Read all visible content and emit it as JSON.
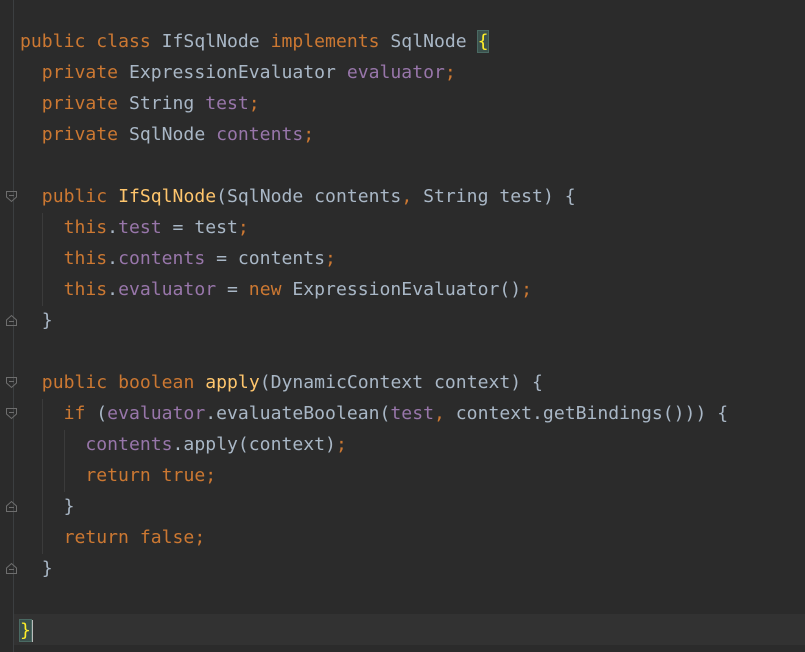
{
  "theme": {
    "background": "#2b2b2b",
    "keyword": "#cc7832",
    "field": "#9876aa",
    "method_decl": "#ffc66d",
    "plain": "#a9b7c6",
    "brace_highlight": "#3b514d"
  },
  "code": {
    "lines": [
      [
        [
          "kw",
          "public"
        ],
        [
          "pl",
          " "
        ],
        [
          "kw",
          "class"
        ],
        [
          "pl",
          " IfSqlNode "
        ],
        [
          "kw",
          "implements"
        ],
        [
          "pl",
          " SqlNode "
        ],
        [
          "hl",
          "{"
        ]
      ],
      [
        [
          "pl",
          "  "
        ],
        [
          "kw",
          "private"
        ],
        [
          "pl",
          " ExpressionEvaluator "
        ],
        [
          "fld",
          "evaluator"
        ],
        [
          "kw",
          ";"
        ]
      ],
      [
        [
          "pl",
          "  "
        ],
        [
          "kw",
          "private"
        ],
        [
          "pl",
          " String "
        ],
        [
          "fld",
          "test"
        ],
        [
          "kw",
          ";"
        ]
      ],
      [
        [
          "pl",
          "  "
        ],
        [
          "kw",
          "private"
        ],
        [
          "pl",
          " SqlNode "
        ],
        [
          "fld",
          "contents"
        ],
        [
          "kw",
          ";"
        ]
      ],
      [],
      [
        [
          "pl",
          "  "
        ],
        [
          "kw",
          "public"
        ],
        [
          "pl",
          " "
        ],
        [
          "fn",
          "IfSqlNode"
        ],
        [
          "pl",
          "(SqlNode contents"
        ],
        [
          "kw",
          ","
        ],
        [
          "pl",
          " String test) {"
        ]
      ],
      [
        [
          "pl",
          "    "
        ],
        [
          "kw",
          "this"
        ],
        [
          "pl",
          "."
        ],
        [
          "fld",
          "test"
        ],
        [
          "pl",
          " = test"
        ],
        [
          "kw",
          ";"
        ]
      ],
      [
        [
          "pl",
          "    "
        ],
        [
          "kw",
          "this"
        ],
        [
          "pl",
          "."
        ],
        [
          "fld",
          "contents"
        ],
        [
          "pl",
          " = contents"
        ],
        [
          "kw",
          ";"
        ]
      ],
      [
        [
          "pl",
          "    "
        ],
        [
          "kw",
          "this"
        ],
        [
          "pl",
          "."
        ],
        [
          "fld",
          "evaluator"
        ],
        [
          "pl",
          " = "
        ],
        [
          "kw",
          "new"
        ],
        [
          "pl",
          " ExpressionEvaluator()"
        ],
        [
          "kw",
          ";"
        ]
      ],
      [
        [
          "pl",
          "  }"
        ]
      ],
      [],
      [
        [
          "pl",
          "  "
        ],
        [
          "kw",
          "public"
        ],
        [
          "pl",
          " "
        ],
        [
          "kw",
          "boolean"
        ],
        [
          "pl",
          " "
        ],
        [
          "fn",
          "apply"
        ],
        [
          "pl",
          "(DynamicContext context) {"
        ]
      ],
      [
        [
          "pl",
          "    "
        ],
        [
          "kw",
          "if"
        ],
        [
          "pl",
          " ("
        ],
        [
          "fld",
          "evaluator"
        ],
        [
          "pl",
          ".evaluateBoolean("
        ],
        [
          "fld",
          "test"
        ],
        [
          "kw",
          ","
        ],
        [
          "pl",
          " context.getBindings())) {"
        ]
      ],
      [
        [
          "pl",
          "      "
        ],
        [
          "fld",
          "contents"
        ],
        [
          "pl",
          ".apply(context)"
        ],
        [
          "kw",
          ";"
        ]
      ],
      [
        [
          "pl",
          "      "
        ],
        [
          "kw",
          "return"
        ],
        [
          "pl",
          " "
        ],
        [
          "kw",
          "true"
        ],
        [
          "kw",
          ";"
        ]
      ],
      [
        [
          "pl",
          "    }"
        ]
      ],
      [
        [
          "pl",
          "    "
        ],
        [
          "kw",
          "return"
        ],
        [
          "pl",
          " "
        ],
        [
          "kw",
          "false"
        ],
        [
          "kw",
          ";"
        ]
      ],
      [
        [
          "pl",
          "  }"
        ]
      ],
      [],
      [
        [
          "hl",
          "}"
        ],
        [
          "caret",
          ""
        ]
      ]
    ]
  },
  "gutter": {
    "fold_markers": [
      {
        "line": 5,
        "kind": "start"
      },
      {
        "line": 9,
        "kind": "end"
      },
      {
        "line": 11,
        "kind": "start"
      },
      {
        "line": 12,
        "kind": "start"
      },
      {
        "line": 15,
        "kind": "end"
      },
      {
        "line": 17,
        "kind": "end"
      }
    ]
  }
}
